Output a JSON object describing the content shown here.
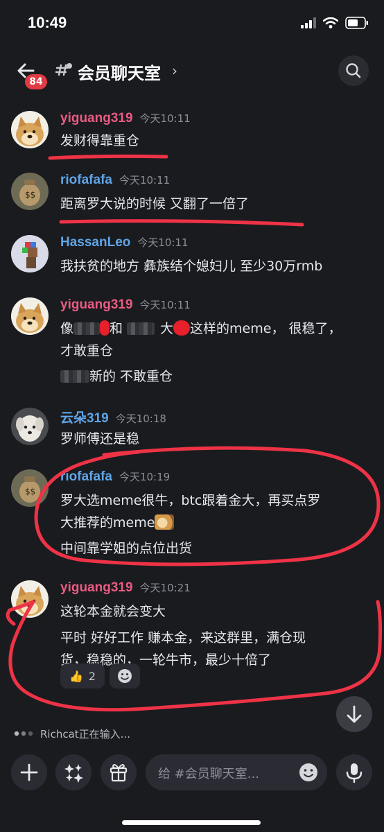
{
  "status_bar": {
    "time": "10:49"
  },
  "header": {
    "unread_badge": "84",
    "channel_title": "会员聊天室",
    "chevron": "›"
  },
  "messages": [
    {
      "author": "yiguang319",
      "time": "今天10:11",
      "lines": [
        "发财得靠重仓"
      ]
    },
    {
      "author": "riofafafa",
      "time": "今天10:11",
      "lines": [
        "距离罗大说的时候 又翻了一倍了"
      ]
    },
    {
      "author": "HassanLeo",
      "time": "今天10:11",
      "lines": [
        "我扶贫的地方 彝族结个媳妇儿 至少30万rmb"
      ]
    },
    {
      "author": "yiguang319",
      "time": "今天10:11",
      "line1": {
        "a": "像",
        "b": "和",
        "c": "大",
        "d": "这样的meme， 很稳了，"
      },
      "line2": "才敢重仓",
      "line3": "新的 不敢重仓"
    },
    {
      "author": "云朵319",
      "time": "今天10:18",
      "lines": [
        "罗师傅还是稳"
      ]
    },
    {
      "author": "riofafafa",
      "time": "今天10:19",
      "lines": [
        "罗大选meme很牛，btc跟着金大，再买点罗",
        "大推荐的meme",
        "中间靠学姐的点位出货"
      ]
    },
    {
      "author": "yiguang319",
      "time": "今天10:21",
      "lines": [
        "这轮本金就会变大",
        "平时 好好工作 赚本金，来这群里，满仓现",
        "货，稳稳的，一轮牛市，最少十倍了"
      ],
      "reaction": {
        "emoji": "👍",
        "count": "2"
      }
    }
  ],
  "typing_indicator": "Richcat正在输入...",
  "composer": {
    "placeholder": "给 #会员聊天室..."
  },
  "colors": {
    "background": "#1a1b1f",
    "author_pink": "#ea5b82",
    "author_blue": "#5fa5e8",
    "badge_red": "#e03a44",
    "annotation_red": "#ee3346"
  },
  "icons": [
    "back-arrow-icon",
    "channel-hash-icon",
    "search-icon",
    "thumbs-up-icon",
    "add-reaction-icon",
    "arrow-down-icon",
    "plus-icon",
    "apps-icon",
    "gift-icon",
    "emoji-icon",
    "microphone-icon",
    "signal-icon",
    "wifi-icon",
    "battery-icon"
  ]
}
